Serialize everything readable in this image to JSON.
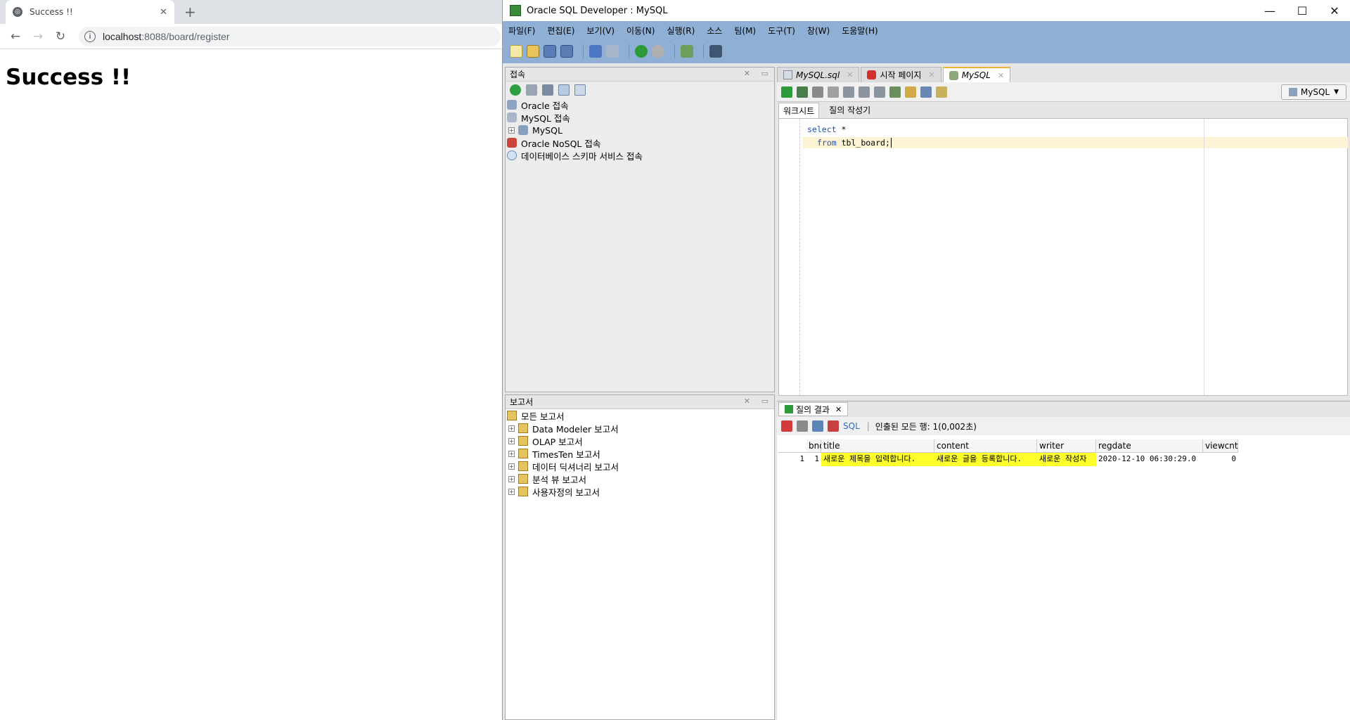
{
  "browser": {
    "tab_title": "Success !!",
    "url_host": "localhost",
    "url_path": ":8088/board/register",
    "heading": "Success !!"
  },
  "sqldev": {
    "title": "Oracle SQL Developer : MySQL",
    "menus": [
      "파일(F)",
      "편집(E)",
      "보기(V)",
      "이동(N)",
      "실행(R)",
      "소스",
      "팀(M)",
      "도구(T)",
      "창(W)",
      "도움말(H)"
    ],
    "connections": {
      "panel_title": "접속",
      "items": [
        "Oracle 접속",
        "MySQL 접속",
        "MySQL",
        "Oracle NoSQL 접속",
        "데이터베이스 스키마 서비스 접속"
      ]
    },
    "reports": {
      "panel_title": "보고서",
      "items": [
        "모든 보고서",
        "Data Modeler 보고서",
        "OLAP 보고서",
        "TimesTen 보고서",
        "데이터 딕셔너리 보고서",
        "분석 뷰 보고서",
        "사용자정의 보고서"
      ]
    },
    "editor_tabs": [
      "MySQL.sql",
      "시작 페이지",
      "MySQL"
    ],
    "connection_selector": "MySQL",
    "worksheet_tabs": [
      "워크시트",
      "질의 작성기"
    ],
    "code": {
      "line1_kw": "select",
      "line1_rest": " *",
      "line2_kw": "from",
      "line2_rest": " tbl_board;"
    },
    "results": {
      "tab_label": "질의 결과",
      "sql_label": "SQL",
      "status": "인출된 모든 행: 1(0,002초)",
      "columns": [
        "bno",
        "title",
        "content",
        "writer",
        "regdate",
        "viewcnt"
      ],
      "rows": [
        [
          "1",
          "1",
          "새로운 제목을 입력합니다.",
          "새로운 글을 등록합니다.",
          "새로운 작성자",
          "2020-12-10 06:30:29.0",
          "0"
        ]
      ]
    }
  }
}
